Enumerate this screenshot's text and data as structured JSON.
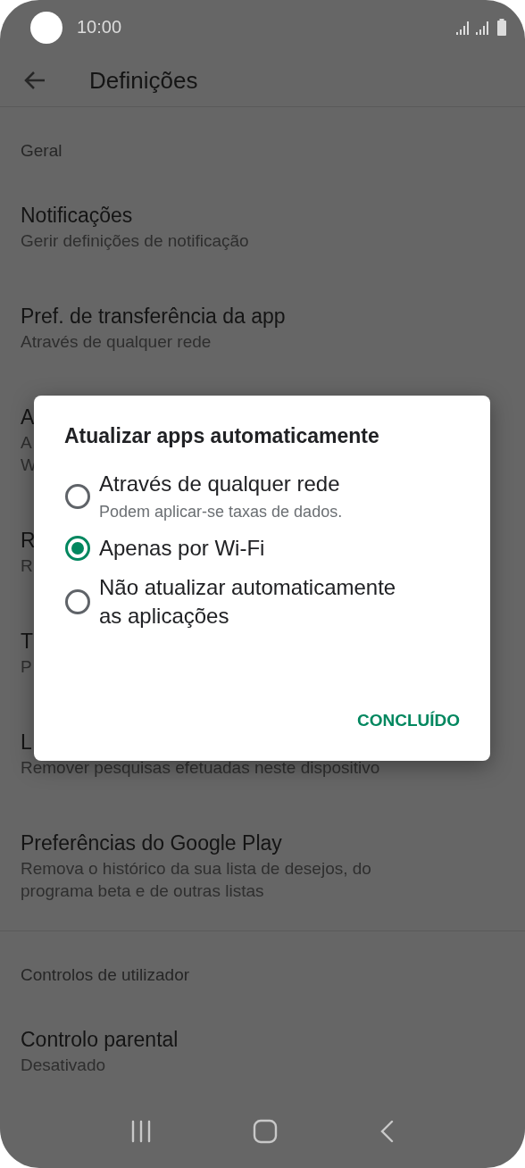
{
  "status_bar": {
    "time": "10:00"
  },
  "app_bar": {
    "title": "Definições"
  },
  "sections": [
    {
      "header": "Geral",
      "items": [
        {
          "title": "Notificações",
          "subtitle_lines": [
            "Gerir definições de notificação"
          ]
        },
        {
          "title": "Pref. de transferência da app",
          "subtitle_lines": [
            "Através de qualquer rede"
          ]
        },
        {
          "title": "A",
          "subtitle_lines": [
            "A",
            "W"
          ]
        },
        {
          "title": "R",
          "subtitle_lines": [
            "R"
          ]
        },
        {
          "title": "T",
          "subtitle_lines": [
            "P"
          ]
        },
        {
          "title": "L",
          "subtitle_lines": [
            "Remover pesquisas efetuadas neste dispositivo"
          ]
        },
        {
          "title": "Preferências do Google Play",
          "subtitle_lines": [
            "Remova o histórico da sua lista de desejos, do",
            "programa beta e de outras listas"
          ]
        }
      ]
    },
    {
      "header": "Controlos de utilizador",
      "items": [
        {
          "title": "Controlo parental",
          "subtitle_lines": [
            "Desativado"
          ]
        }
      ]
    }
  ],
  "dialog": {
    "title": "Atualizar apps automaticamente",
    "options": [
      {
        "label": "Através de qualquer rede",
        "detail": "Podem aplicar-se taxas de dados.",
        "selected": false
      },
      {
        "label": "Apenas por Wi-Fi",
        "selected": true
      },
      {
        "label": "Não atualizar automaticamente as aplicações",
        "selected": false
      }
    ],
    "button": "CONCLUÍDO"
  }
}
